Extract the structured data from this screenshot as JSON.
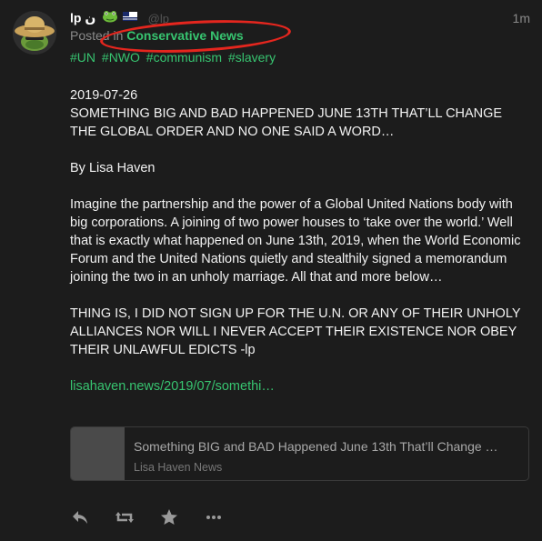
{
  "post": {
    "author": {
      "display_name": "lp ن",
      "handle": "@lp",
      "avatar_icon": "hat-frog-avatar",
      "emoji_icons": [
        "frog-icon",
        "flag-icon"
      ]
    },
    "timestamp": "1m",
    "posted_in_label": "Posted in",
    "group_name": "Conservative News",
    "hashtags": [
      "#UN",
      "#NWO",
      "#communism",
      "#slavery"
    ],
    "body": {
      "date": "2019-07-26",
      "headline": "SOMETHING BIG AND BAD HAPPENED JUNE 13TH THAT’LL CHANGE THE GLOBAL ORDER AND NO ONE SAID A WORD…",
      "byline": "By Lisa Haven",
      "paragraph": "Imagine the partnership and the power of a Global United Nations body with big corporations. A joining of two power houses to ‘take over the world.’ Well that is exactly what happened on June 13th, 2019, when the World Economic Forum and the United Nations quietly and stealthily signed a memorandum joining the two in an unholy marriage. All that and more below…",
      "comment": "THING IS, I DID NOT SIGN UP FOR THE U.N. OR ANY OF THEIR UNHOLY ALLIANCES NOR WILL I NEVER ACCEPT THEIR EXISTENCE NOR OBEY THEIR UNLAWFUL EDICTS -lp",
      "link_text": "lisahaven.news/2019/07/somethi…"
    },
    "link_card": {
      "title": "Something BIG and BAD Happened June 13th That’ll Change …",
      "source": "Lisa Haven News"
    },
    "actions": [
      "reply-icon",
      "repost-icon",
      "favorite-icon",
      "more-icon"
    ]
  },
  "colors": {
    "background": "#1c1c1c",
    "accent_green": "#37c470",
    "annotation_red": "#e5261e",
    "muted_text": "#8a8a8a"
  }
}
